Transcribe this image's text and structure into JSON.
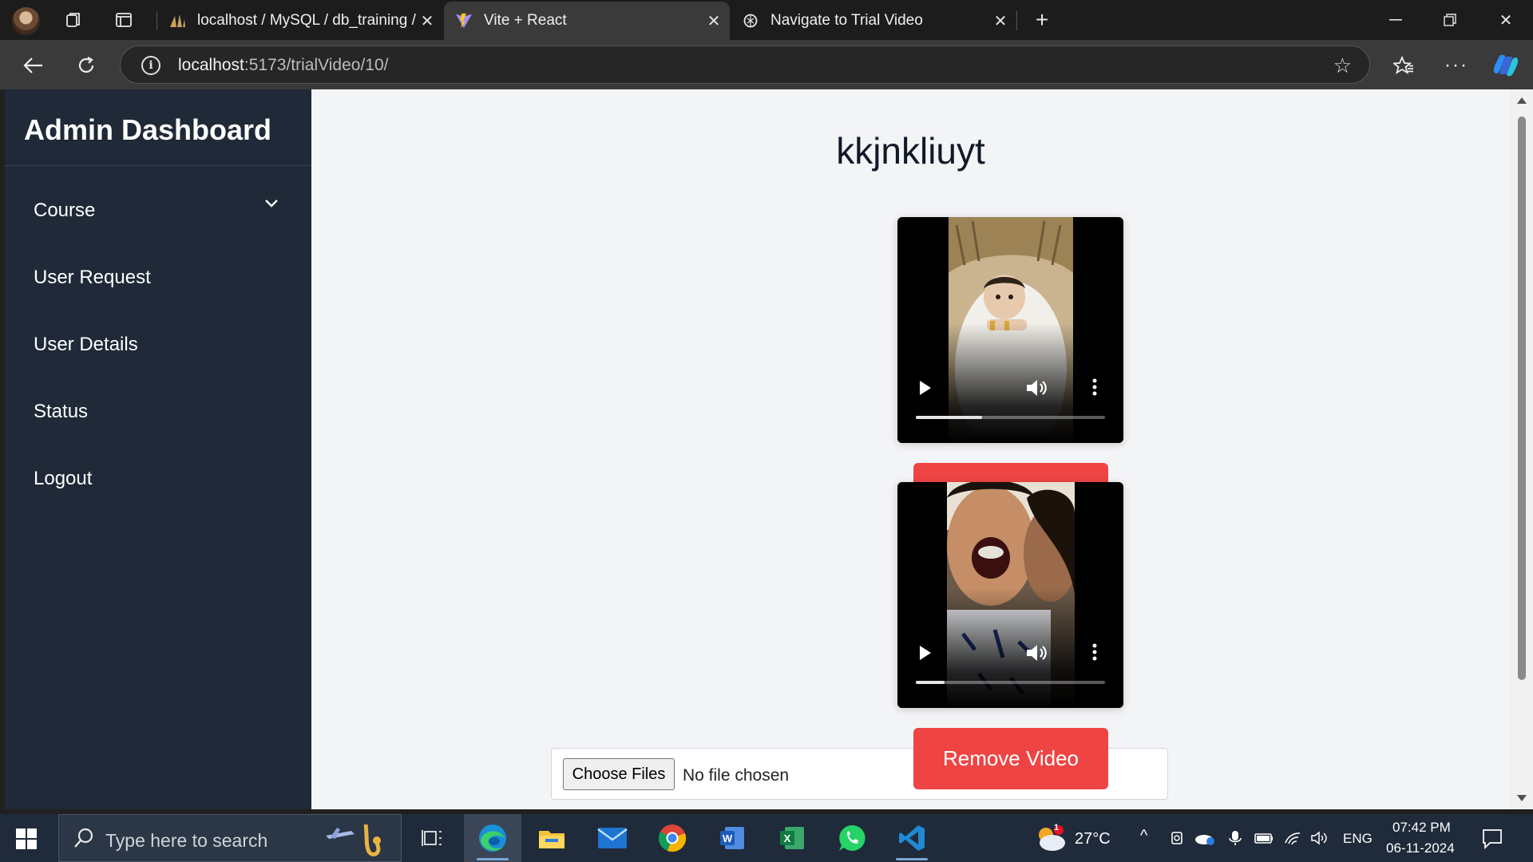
{
  "browser": {
    "tabs": [
      {
        "title": "localhost / MySQL / db_training /",
        "favicon": "phpmyadmin-sail-icon",
        "active": false
      },
      {
        "title": "Vite + React",
        "favicon": "vite-logo-icon",
        "active": true
      },
      {
        "title": "Navigate to Trial Video",
        "favicon": "chatgpt-logo-icon",
        "active": false
      }
    ],
    "address": {
      "host": "localhost",
      "rest": ":5173/trialVideo/10/"
    }
  },
  "sidebar": {
    "title": "Admin Dashboard",
    "items": [
      {
        "label": "Course",
        "has_dropdown": true
      },
      {
        "label": "User Request"
      },
      {
        "label": "User Details"
      },
      {
        "label": "Status"
      },
      {
        "label": "Logout"
      }
    ]
  },
  "main": {
    "title": "kkjnkliuyt",
    "videos": [
      {
        "progress": 0.35,
        "remove_label": "Remove Video"
      },
      {
        "progress": 0.15,
        "remove_label": "Remove Video"
      }
    ],
    "file_input": {
      "button_label": "Choose Files",
      "status": "No file chosen"
    }
  },
  "taskbar": {
    "search_placeholder": "Type here to search",
    "weather": {
      "temp": "27°C",
      "badge": "1"
    },
    "language": "ENG",
    "time": "07:42 PM",
    "date": "06-11-2024"
  },
  "colors": {
    "sidebar_bg": "#1f2937",
    "page_bg": "#f3f4f6",
    "danger": "#ef4444",
    "taskbar_bg": "#1f2a3a"
  }
}
